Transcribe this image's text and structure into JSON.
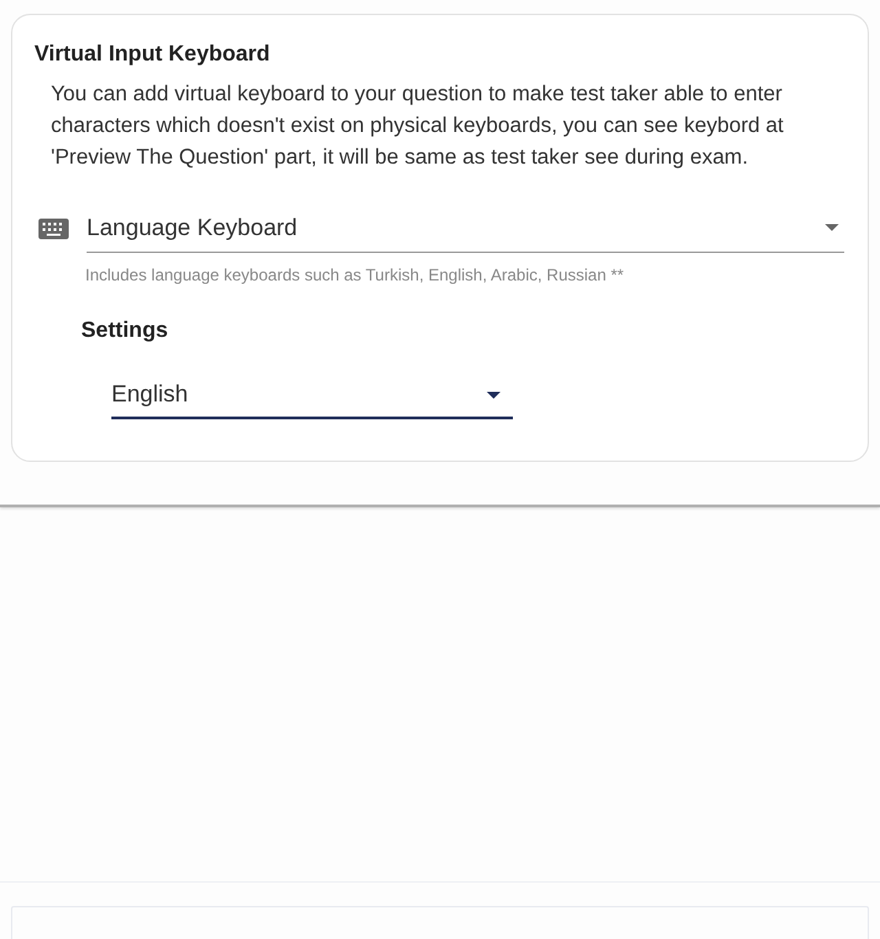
{
  "card": {
    "title": "Virtual Input Keyboard",
    "description": "You can add virtual keyboard to your question to make test taker able to enter characters which doesn't exist on physical keyboards, you can see keybord at 'Preview The Question' part, it will be same as test taker see during exam.",
    "keyboard_select": {
      "value": "Language Keyboard",
      "helper": "Includes language keyboards such as Turkish, English, Arabic, Russian **"
    },
    "settings": {
      "heading": "Settings",
      "language_select": {
        "value": "English"
      }
    }
  }
}
